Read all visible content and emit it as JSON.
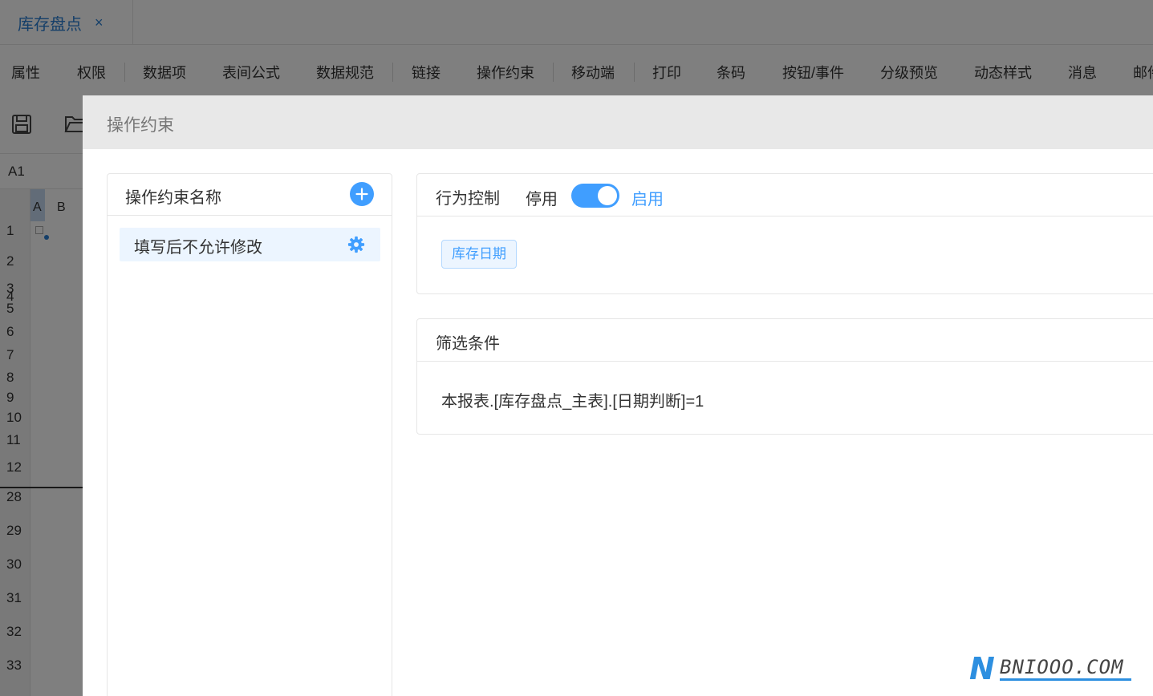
{
  "tab": {
    "label": "库存盘点",
    "close": "×"
  },
  "menu": [
    {
      "label": "属性"
    },
    {
      "label": "权限"
    },
    {
      "label": "数据项"
    },
    {
      "label": "表间公式"
    },
    {
      "label": "数据规范"
    },
    {
      "label": "链接"
    },
    {
      "label": "操作约束"
    },
    {
      "label": "移动端"
    },
    {
      "label": "打印"
    },
    {
      "label": "条码"
    },
    {
      "label": "按钮/事件"
    },
    {
      "label": "分级预览"
    },
    {
      "label": "动态样式"
    },
    {
      "label": "消息"
    },
    {
      "label": "邮件"
    }
  ],
  "toolbar": {
    "icons": [
      "save-icon",
      "folder-open-icon"
    ]
  },
  "cell_ref": "A1",
  "sheet": {
    "columns": [
      "A",
      "B"
    ],
    "rows": [
      "1",
      "2",
      "3",
      "4",
      "5",
      "6",
      "7",
      "8",
      "9",
      "10",
      "11",
      "12",
      "28",
      "29",
      "30",
      "31",
      "32",
      "33"
    ]
  },
  "dialog": {
    "title": "操作约束",
    "left_panel": {
      "title": "操作约束名称",
      "add_icon": "plus-icon",
      "items": [
        {
          "label": "填写后不允许修改",
          "icon": "gear-icon"
        }
      ]
    },
    "behavior": {
      "title": "行为控制",
      "off_label": "停用",
      "on_label": "启用",
      "enabled": true,
      "tags": [
        "库存日期"
      ]
    },
    "filter": {
      "title": "筛选条件",
      "expression": "本报表.[库存盘点_主表].[日期判断]=1"
    }
  },
  "colors": {
    "accent": "#409eff",
    "tab_text": "#2b7fd3",
    "overlay": "rgba(0,0,0,0.5)"
  },
  "watermark": {
    "letter": "N",
    "text": "BNIOOO.COM"
  }
}
